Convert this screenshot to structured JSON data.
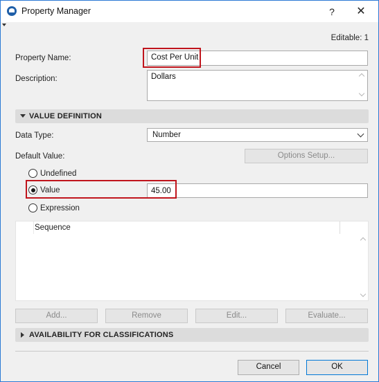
{
  "window": {
    "title": "Property Manager",
    "help_glyph": "?",
    "close_glyph": "✕"
  },
  "status": {
    "editable": "Editable: 1"
  },
  "property": {
    "name_label": "Property Name:",
    "name_value": "Cost Per Unit",
    "description_label": "Description:",
    "description_value": "Dollars"
  },
  "value_definition": {
    "header": "VALUE DEFINITION",
    "data_type_label": "Data Type:",
    "data_type_value": "Number",
    "default_value_label": "Default Value:",
    "options_setup_label": "Options Setup...",
    "radios": {
      "undefined": "Undefined",
      "value": "Value",
      "expression": "Expression"
    },
    "selected_radio": "value",
    "value_input": "45.00"
  },
  "list": {
    "column_header": "Sequence"
  },
  "list_buttons": {
    "add": "Add...",
    "remove": "Remove",
    "edit": "Edit...",
    "evaluate": "Evaluate..."
  },
  "classifications": {
    "header": "AVAILABILITY FOR CLASSIFICATIONS"
  },
  "footer": {
    "cancel": "Cancel",
    "ok": "OK"
  },
  "colors": {
    "highlight": "#c0141c",
    "accent": "#0078d7"
  }
}
